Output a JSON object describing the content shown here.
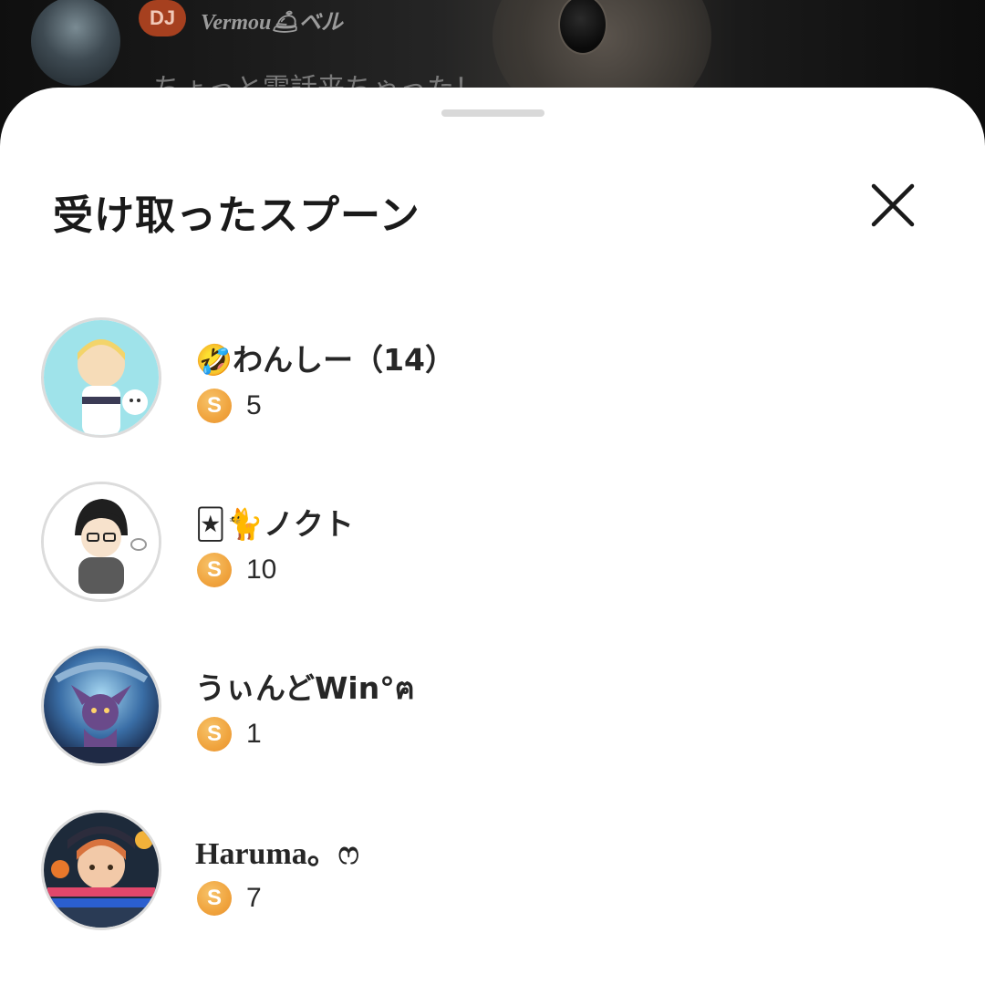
{
  "background_chat": {
    "dj_badge": "DJ",
    "dj_name": "Vermou🛎ベル",
    "message": "ちょっと電話来ちゃった！"
  },
  "sheet": {
    "title": "受け取ったスプーン",
    "close_icon": "close-icon"
  },
  "spoon_icon_letter": "S",
  "accent_color": "#f0a43e",
  "users": [
    {
      "name": "🤣わんしー（14）",
      "spoons": "5"
    },
    {
      "name": "🃏🐈ノクト",
      "spoons": "10"
    },
    {
      "name": "うぃんどWin°ฅ",
      "spoons": "1"
    },
    {
      "name": "Haruma。ෆ",
      "spoons": "7"
    }
  ]
}
